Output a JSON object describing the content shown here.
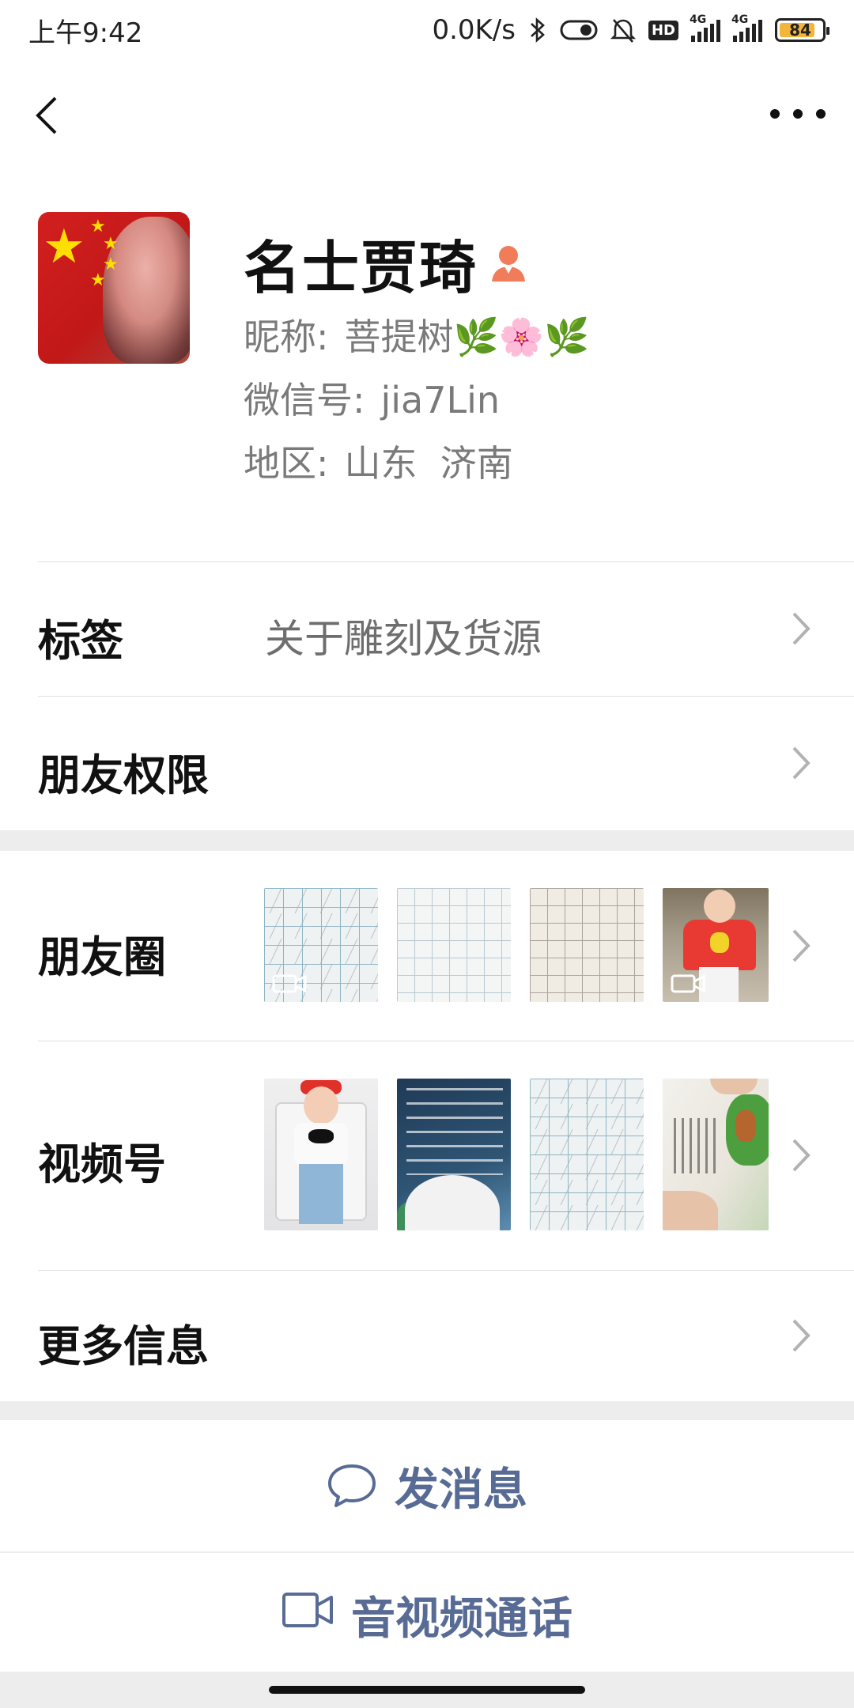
{
  "status_bar": {
    "time": "上午9:42",
    "speed": "0.0K/s",
    "hd": "HD",
    "network1": "4G",
    "network2": "4G",
    "battery_level": "84",
    "battery_fraction": 0.84
  },
  "nav": {
    "back_icon": "chevron-left-icon",
    "more_icon": "more-dots-icon"
  },
  "profile": {
    "name": "名士贾琦",
    "gender_icon": "female-icon",
    "nickname_label": "昵称:",
    "nickname_value": "菩提树🌿🌸🌿",
    "wechat_id_label": "微信号:",
    "wechat_id_value": "jia7Lin",
    "region_label": "地区:",
    "region_value": "山东  济南"
  },
  "rows": {
    "tags_label": "标签",
    "tags_value": "关于雕刻及货源",
    "friend_permissions_label": "朋友权限",
    "moments_label": "朋友圈",
    "channels_label": "视频号",
    "more_info_label": "更多信息"
  },
  "actions": {
    "send_message": "发消息",
    "send_message_icon": "chat-bubble-icon",
    "video_call": "音视频通话",
    "video_call_icon": "video-camera-icon"
  },
  "colors": {
    "link_blue": "#576b95",
    "background": "#ededed",
    "gender_icon": "#f07c5a"
  }
}
